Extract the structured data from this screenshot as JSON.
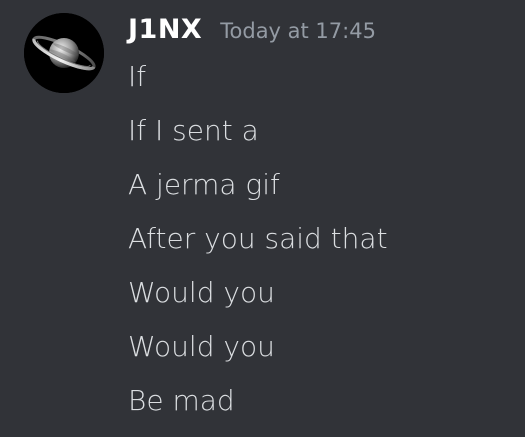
{
  "message": {
    "author": "J1NX",
    "timestamp": "Today at 17:45",
    "avatar_icon": "saturn-icon",
    "lines": [
      "If",
      "If I sent a",
      "A jerma gif",
      "After you said that",
      "Would you",
      "Would you",
      "Be mad"
    ]
  },
  "colors": {
    "background": "#313338",
    "username": "#ffffff",
    "timestamp": "#949ba4",
    "message_text": "#dbdee1"
  }
}
